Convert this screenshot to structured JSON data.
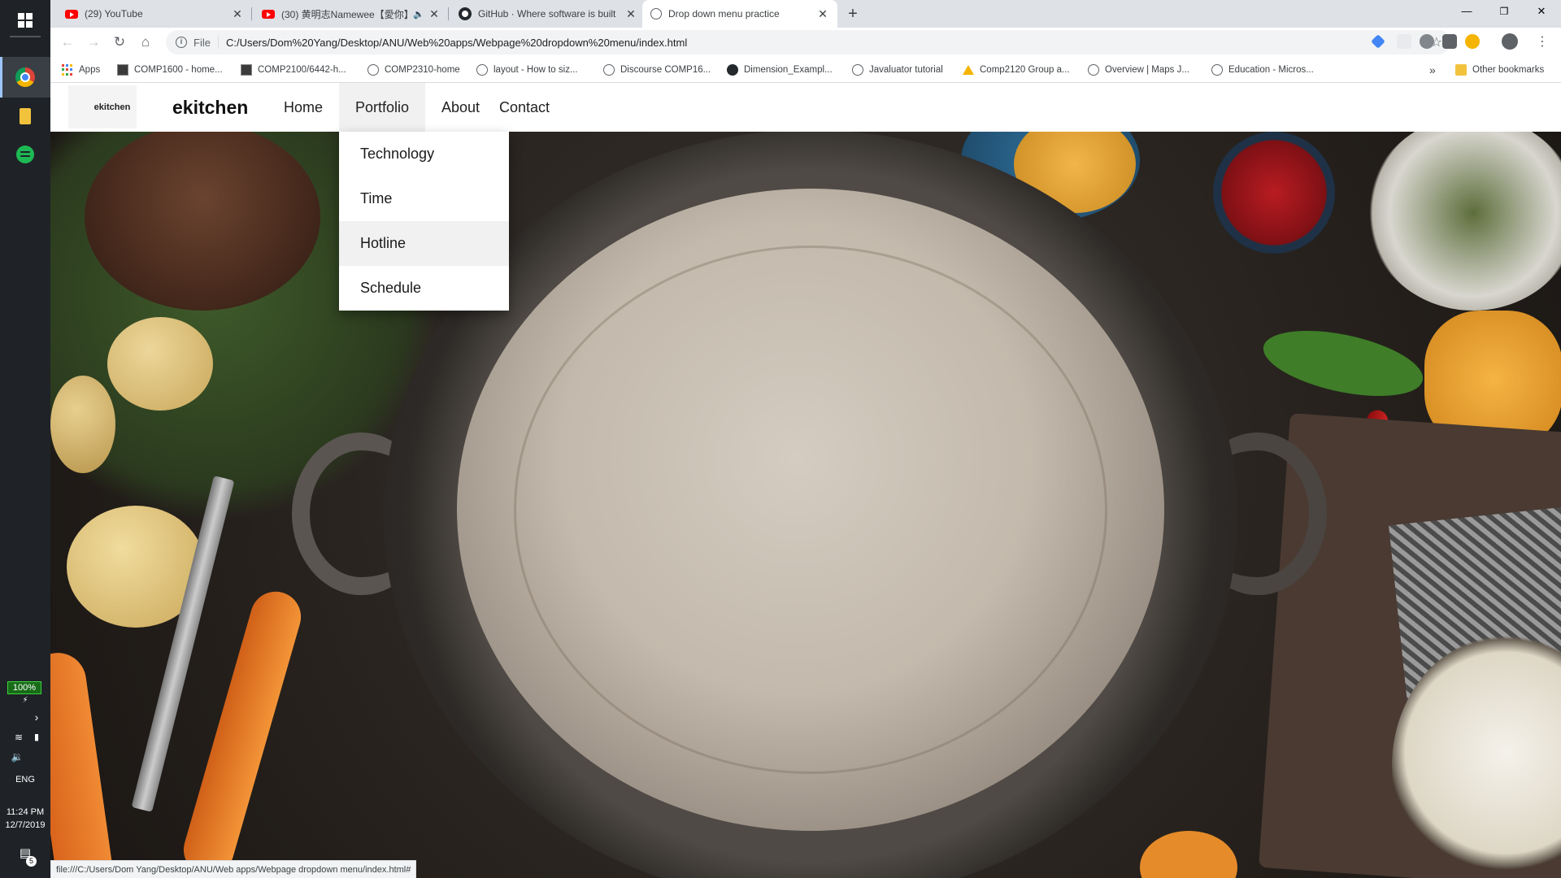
{
  "taskbar": {
    "battery": "100%",
    "language": "ENG",
    "time": "11:24 PM",
    "date": "12/7/2019",
    "notification_count": "5"
  },
  "browser": {
    "tabs": [
      {
        "title": "(29) YouTube",
        "icon": "youtube-icon"
      },
      {
        "title": "(30) 黄明志Namewee【愛你】",
        "icon": "youtube-icon"
      },
      {
        "title": "GitHub · Where software is built",
        "icon": "github-icon"
      },
      {
        "title": "Drop down menu practice",
        "icon": "globe-icon"
      }
    ],
    "scheme_label": "File",
    "url": "C:/Users/Dom%20Yang/Desktop/ANU/Web%20apps/Webpage%20dropdown%20menu/index.html",
    "bookmarks": [
      "Apps",
      "COMP1600 - home...",
      "COMP2100/6442-h...",
      "COMP2310-home",
      "layout - How to siz...",
      "Discourse COMP16...",
      "Dimension_Exampl...",
      "Javaluator tutorial",
      "Comp2120 Group a...",
      "Overview | Maps J...",
      "Education - Micros..."
    ],
    "more_bookmarks": "»",
    "other_bookmarks": "Other bookmarks"
  },
  "site": {
    "logo_text": "ekitchen",
    "brand": "ekitchen",
    "nav": [
      "Home",
      "Portfolio",
      "About",
      "Contact"
    ],
    "dropdown": [
      "Technology",
      "Time",
      "Hotline",
      "Schedule"
    ]
  },
  "status_url": "file:///C:/Users/Dom Yang/Desktop/ANU/Web apps/Webpage dropdown menu/index.html#",
  "colors": {
    "tabstrip": "#dee1e6",
    "hover_item": "#f1f1f1",
    "accent_blue": "#1a73e8"
  }
}
